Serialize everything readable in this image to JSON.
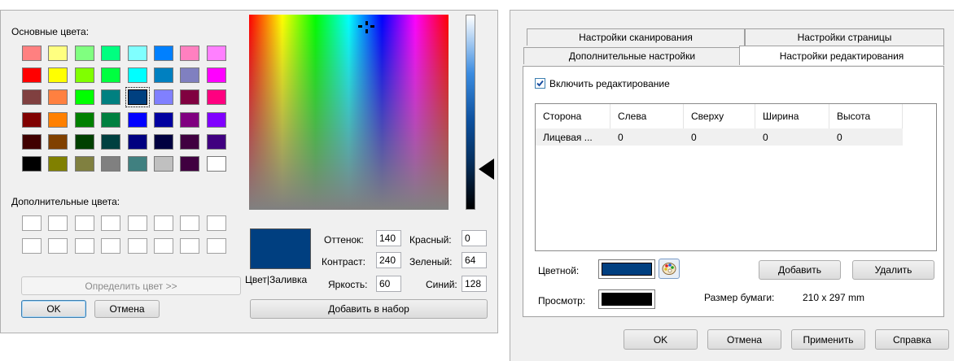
{
  "color_dialog": {
    "basic_colors_label": "Основные цвета:",
    "basic_colors": [
      "#ff8080",
      "#ffff80",
      "#80ff80",
      "#00ff80",
      "#80ffff",
      "#0080ff",
      "#ff80c0",
      "#ff80ff",
      "#ff0000",
      "#ffff00",
      "#80ff00",
      "#00ff40",
      "#00ffff",
      "#0080c0",
      "#8080c0",
      "#ff00ff",
      "#804040",
      "#ff8040",
      "#00ff00",
      "#008080",
      "#004080",
      "#8080ff",
      "#800040",
      "#ff0080",
      "#800000",
      "#ff8000",
      "#008000",
      "#008040",
      "#0000ff",
      "#0000a0",
      "#800080",
      "#8000ff",
      "#400000",
      "#804000",
      "#004000",
      "#004040",
      "#000080",
      "#000040",
      "#400040",
      "#400080",
      "#000000",
      "#808000",
      "#808040",
      "#808080",
      "#408080",
      "#c0c0c0",
      "#400040",
      "#ffffff"
    ],
    "selected_index": 20,
    "custom_colors_label": "Дополнительные цвета:",
    "define_button": "Определить цвет >>",
    "ok_button": "OK",
    "cancel_button": "Отмена",
    "preview_label": "Цвет|Заливка",
    "preview_color": "#003f80",
    "hue_label": "Оттенок:",
    "hue_value": "140",
    "sat_label": "Контраст:",
    "sat_value": "240",
    "lum_label": "Яркость:",
    "lum_value": "60",
    "red_label": "Красный:",
    "red_value": "0",
    "green_label": "Зеленый:",
    "green_value": "64",
    "blue_label": "Синий:",
    "blue_value": "128",
    "add_button": "Добавить в набор"
  },
  "settings_dialog": {
    "tabs": {
      "scan": "Настройки сканирования",
      "page": "Настройки страницы",
      "advanced": "Дополнительные настройки",
      "edit": "Настройки редактирования"
    },
    "enable_edit_label": "Включить редактирование",
    "enable_edit_checked": true,
    "columns": [
      "Сторона",
      "Слева",
      "Сверху",
      "Ширина",
      "Высота"
    ],
    "rows": [
      [
        "Лицевая ...",
        "0",
        "0",
        "0",
        "0"
      ]
    ],
    "color_label": "Цветной:",
    "color_value": "#003f80",
    "preview_label": "Просмотр:",
    "preview_value": "#000000",
    "add_button": "Добавить",
    "delete_button": "Удалить",
    "paper_size_label": "Размер бумаги:",
    "paper_size_value": "210 x 297 mm",
    "ok_button": "OK",
    "cancel_button": "Отмена",
    "apply_button": "Применить",
    "help_button": "Справка"
  }
}
